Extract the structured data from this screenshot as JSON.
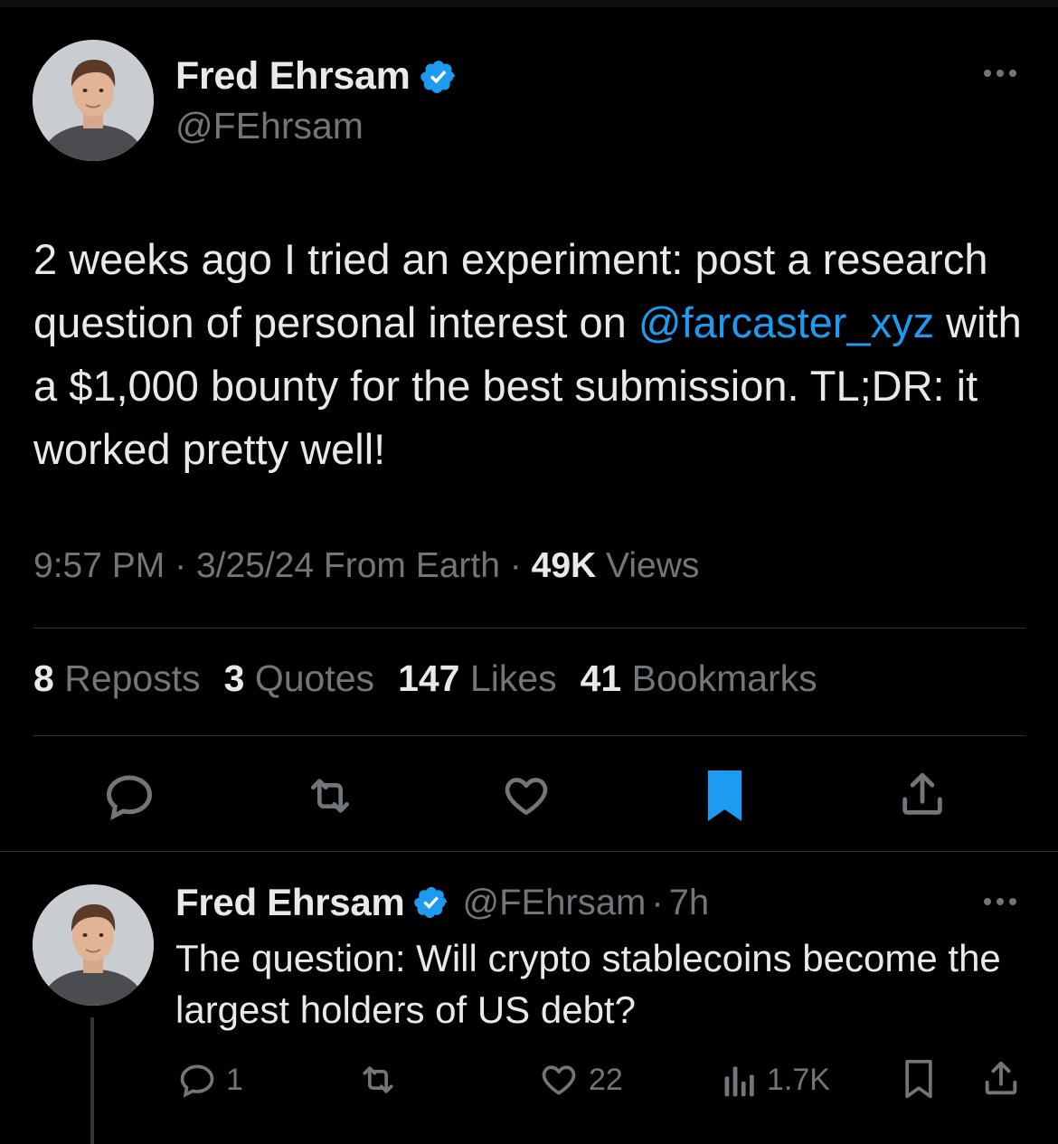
{
  "main_tweet": {
    "author_name": "Fred Ehrsam",
    "handle": "@FEhrsam",
    "text_before_mention": "2 weeks ago I tried an experiment: post a research question of personal interest on ",
    "mention": "@farcaster_xyz",
    "text_after_mention": " with a $1,000 bounty for the best submission. TL;DR: it worked pretty well!",
    "time": "9:57 PM",
    "date": "3/25/24",
    "location": "From Earth",
    "separator": "·",
    "views_count": "49K",
    "views_label": "Views",
    "stats": [
      {
        "count": "8",
        "label": "Reposts"
      },
      {
        "count": "3",
        "label": "Quotes"
      },
      {
        "count": "147",
        "label": "Likes"
      },
      {
        "count": "41",
        "label": "Bookmarks"
      }
    ]
  },
  "reply": {
    "author_name": "Fred Ehrsam",
    "handle": "@FEhrsam",
    "separator": "·",
    "time_ago": "7h",
    "text": "The question: Will crypto stablecoins become the largest holders of US debt?",
    "reply_count": "1",
    "like_count": "22",
    "view_count": "1.7K"
  },
  "colors": {
    "background": "#000000",
    "accent": "#1d9bf0",
    "text_primary": "#e7e9ea",
    "text_secondary": "#71767b",
    "divider": "#2f3336"
  },
  "icons": {
    "verified": "verified-badge-icon",
    "more": "more-icon",
    "reply": "reply-icon",
    "repost": "repost-icon",
    "like": "heart-icon",
    "bookmark": "bookmark-icon",
    "share": "share-icon",
    "views": "views-icon"
  }
}
